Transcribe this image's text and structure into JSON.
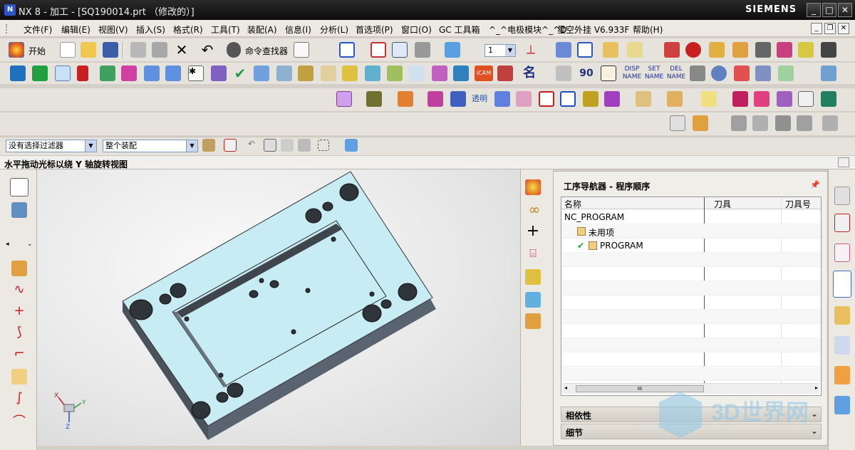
{
  "window": {
    "title": "NX 8 - 加工 - [SQ190014.prt （修改的）]",
    "brand": "SIEMENS",
    "min": "_",
    "max": "□",
    "close": "✕"
  },
  "menu": [
    "文件(F)",
    "编辑(E)",
    "视图(V)",
    "插入(S)",
    "格式(R)",
    "工具(T)",
    "装配(A)",
    "信息(I)",
    "分析(L)",
    "首选项(P)",
    "窗口(O)",
    "GC 工具箱",
    "^_^电极模块^_^D",
    "星空外挂 V6.933F",
    "帮助(H)"
  ],
  "toolbar": {
    "start_label": "开始",
    "cmd_finder": "命令查找器",
    "layer_value": "1",
    "icam": "iCAM",
    "ming": "名",
    "disp": "DISP NAME",
    "set": "SET NAME",
    "del": "DEL NAME"
  },
  "filter": {
    "selection_filter": "没有选择过滤器",
    "scope": "整个装配"
  },
  "cue": "水平拖动光标以绕 Y 轴旋转视图",
  "navigator": {
    "title": "工序导航器 - 程序顺序",
    "columns": [
      "名称",
      "刀具",
      "刀具号"
    ],
    "rows": [
      {
        "name": "NC_PROGRAM",
        "level": 0
      },
      {
        "name": "未用项",
        "level": 1
      },
      {
        "name": "PROGRAM",
        "level": 1
      }
    ],
    "scroll_thumb": "III",
    "sections": [
      "相依性",
      "细节"
    ]
  },
  "triad": {
    "x": "X",
    "y": "Y",
    "z": "Z"
  },
  "watermark": "3D世界网",
  "colors": {
    "part": "#c8ecf4",
    "part_side": "#4f5a66",
    "titlebar": "#111111",
    "accent": "#2b56c8"
  }
}
